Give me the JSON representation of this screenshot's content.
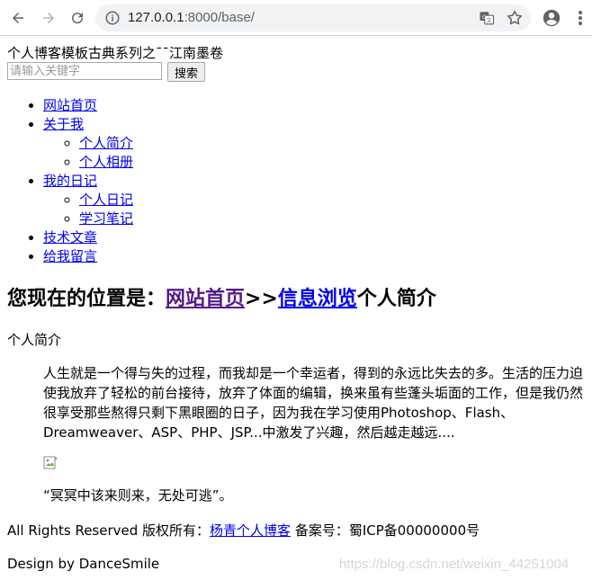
{
  "browser": {
    "url_host": "127.0.0.1",
    "url_rest": ":8000/base/"
  },
  "header": {
    "site_title": "个人博客模板古典系列之¯¯江南墨卷",
    "search_placeholder": "请输入关键字",
    "search_button": "搜索"
  },
  "nav": {
    "home": "网站首页",
    "about": "关于我",
    "about_children": [
      "个人简介",
      "个人相册"
    ],
    "diary": "我的日记",
    "diary_children": [
      "个人日记",
      "学习笔记"
    ],
    "tech": "技术文章",
    "message": "给我留言"
  },
  "location": {
    "prefix": "您现在的位置是：",
    "home_link": "网站首页",
    "sep": ">>",
    "browse_link": "信息浏览",
    "current": "个人简介"
  },
  "content": {
    "section_label": "个人简介",
    "quote": "人生就是一个得与失的过程，而我却是一个幸运者，得到的永远比失去的多。生活的压力迫使我放弃了轻松的前台接待，放弃了体面的编辑，换来虽有些蓬头垢面的工作，但是我仍然很享受那些熬得只剩下黑眼圈的日子，因为我在学习使用Photoshop、Flash、Dreamweaver、ASP、PHP、JSP...中激发了兴趣，然后越走越远....",
    "motto": "“冥冥中该来则来，无处可逃”。"
  },
  "footer": {
    "rights": "All Rights Reserved 版权所有：",
    "blog_link": "杨青个人博客",
    "icp": " 备案号：蜀ICP备00000000号",
    "design": "Design by DanceSmile"
  },
  "watermark": "https://blog.csdn.net/weixin_44251004"
}
